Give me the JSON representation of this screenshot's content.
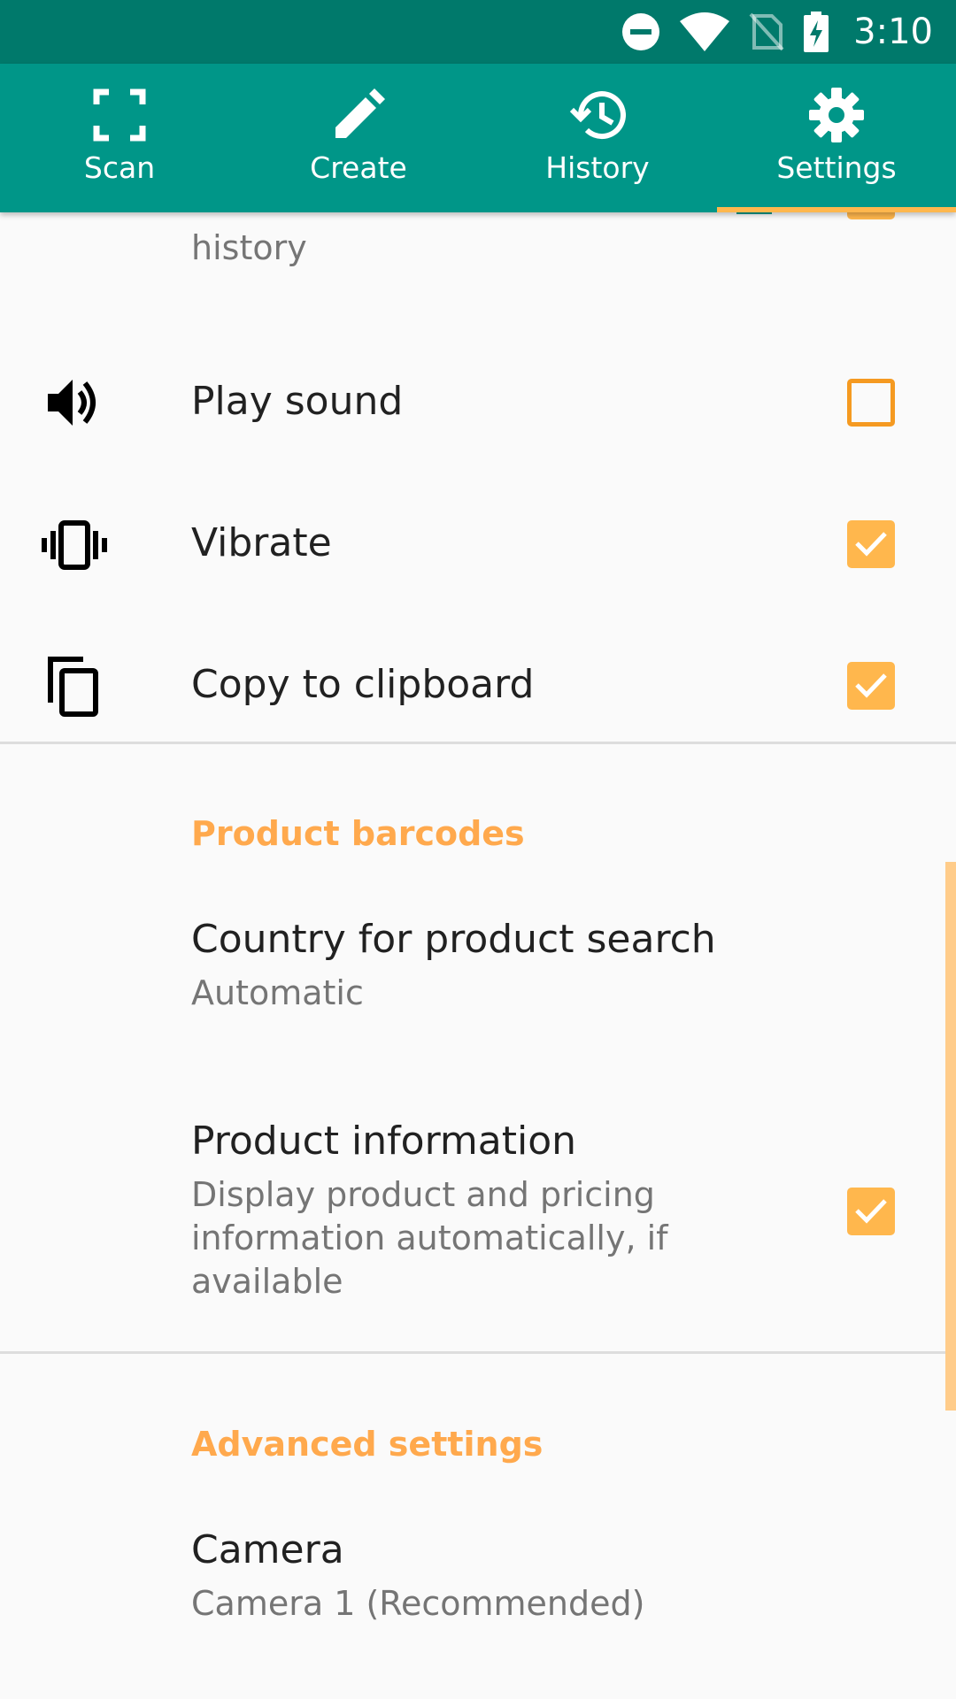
{
  "status_bar": {
    "time": "3:10",
    "icons": [
      "do-not-disturb-icon",
      "wifi-icon",
      "no-sim-icon",
      "battery-charging-icon"
    ]
  },
  "tabs": [
    {
      "label": "Scan",
      "icon": "scan-frame-icon",
      "active": false
    },
    {
      "label": "Create",
      "icon": "pencil-icon",
      "active": false
    },
    {
      "label": "History",
      "icon": "history-icon",
      "active": false
    },
    {
      "label": "Settings",
      "icon": "gear-icon",
      "active": true
    }
  ],
  "settings": {
    "partial_item": {
      "subtitle_tail": "history",
      "checked": true
    },
    "items": [
      {
        "title": "Play sound",
        "icon": "volume-icon",
        "checked": false
      },
      {
        "title": "Vibrate",
        "icon": "vibrate-icon",
        "checked": true
      },
      {
        "title": "Copy to clipboard",
        "icon": "copy-icon",
        "checked": true
      }
    ],
    "product_section": {
      "header": "Product barcodes",
      "country": {
        "title": "Country for product search",
        "value": "Automatic"
      },
      "product_info": {
        "title": "Product information",
        "subtitle": "Display product and pricing information automatically, if available",
        "checked": true
      }
    },
    "advanced_section": {
      "header": "Advanced settings",
      "camera": {
        "title": "Camera",
        "value": "Camera 1 (Recommended)"
      }
    }
  },
  "colors": {
    "primary": "#009688",
    "primary_dark": "#00796b",
    "accent": "#ffb74d",
    "section_header": "#ffa94d"
  }
}
